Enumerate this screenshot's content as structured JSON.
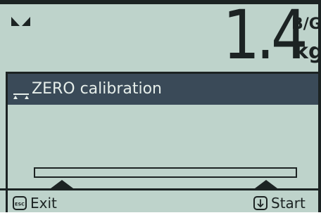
{
  "display": {
    "background_color": "#bed3cb",
    "ink_color": "#1c2323",
    "title_bar_color": "#3a4a58",
    "status_icon": "motion-indicator-icon",
    "weight": {
      "value": "1.4",
      "mode": "B/G",
      "unit": "kg"
    }
  },
  "panel": {
    "title_icon": "scale-platform-icon",
    "title": "ZERO calibration",
    "diagram": {
      "beam": "scale-beam",
      "supports": [
        "support-left",
        "support-right"
      ]
    }
  },
  "softkeys": {
    "left": {
      "icon": "esc-key-icon",
      "icon_text": "ESC",
      "label": "Exit"
    },
    "right": {
      "icon": "down-arrow-key-icon",
      "label": "Start"
    }
  }
}
